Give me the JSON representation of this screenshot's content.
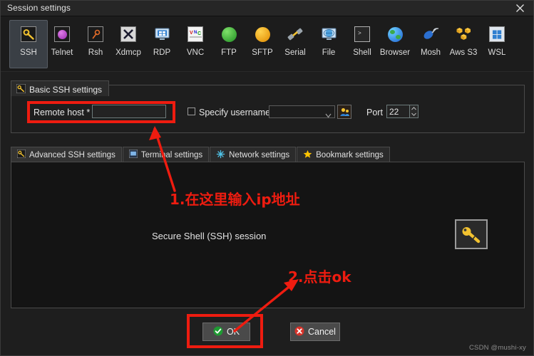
{
  "window": {
    "title": "Session settings",
    "close_icon": "close-icon"
  },
  "toolbar": {
    "items": [
      {
        "label": "SSH",
        "icon": "ssh-key-icon",
        "selected": true
      },
      {
        "label": "Telnet",
        "icon": "telnet-icon",
        "selected": false
      },
      {
        "label": "Rsh",
        "icon": "rsh-icon",
        "selected": false
      },
      {
        "label": "Xdmcp",
        "icon": "xdmcp-x-icon",
        "selected": false
      },
      {
        "label": "RDP",
        "icon": "rdp-monitor-icon",
        "selected": false
      },
      {
        "label": "VNC",
        "icon": "vnc-icon",
        "selected": false
      },
      {
        "label": "FTP",
        "icon": "ftp-globe-icon",
        "selected": false
      },
      {
        "label": "SFTP",
        "icon": "sftp-globe-icon",
        "selected": false
      },
      {
        "label": "Serial",
        "icon": "serial-plug-icon",
        "selected": false
      },
      {
        "label": "File",
        "icon": "file-monitor-icon",
        "selected": false
      },
      {
        "label": "Shell",
        "icon": "shell-terminal-icon",
        "selected": false
      },
      {
        "label": "Browser",
        "icon": "browser-globe-icon",
        "selected": false
      },
      {
        "label": "Mosh",
        "icon": "mosh-dish-icon",
        "selected": false
      },
      {
        "label": "Aws S3",
        "icon": "aws-s3-cubes-icon",
        "selected": false
      },
      {
        "label": "WSL",
        "icon": "wsl-windows-icon",
        "selected": false
      }
    ]
  },
  "basic_group": {
    "tab_label": "Basic SSH settings",
    "tab_icon": "ssh-key-icon",
    "remote_host_label": "Remote host *",
    "remote_host_value": "",
    "remote_host_placeholder": "",
    "specify_username_label": "Specify username",
    "specify_username_checked": false,
    "username_value": "",
    "username_dropdown_icon": "chevron-down-icon",
    "user_picker_icon": "users-icon",
    "port_label": "Port",
    "port_value": "22",
    "port_spinner_icon": "spinner-up-down-icon"
  },
  "subtabs": [
    {
      "label": "Advanced SSH settings",
      "icon": "ssh-key-icon",
      "active": true
    },
    {
      "label": "Terminal settings",
      "icon": "terminal-icon",
      "active": false
    },
    {
      "label": "Network settings",
      "icon": "network-icon",
      "active": false
    },
    {
      "label": "Bookmark settings",
      "icon": "star-icon",
      "active": false
    }
  ],
  "content": {
    "session_description": "Secure Shell (SSH) session",
    "key_icon": "key-icon"
  },
  "buttons": {
    "ok_label": "OK",
    "ok_icon": "green-check-icon",
    "cancel_label": "Cancel",
    "cancel_icon": "red-x-icon"
  },
  "annotations": {
    "step1_text": "1.在这里输入ip地址",
    "step2_text": "2.点击ok",
    "color": "#ee1c10"
  },
  "watermark": "CSDN @mushi-xy"
}
